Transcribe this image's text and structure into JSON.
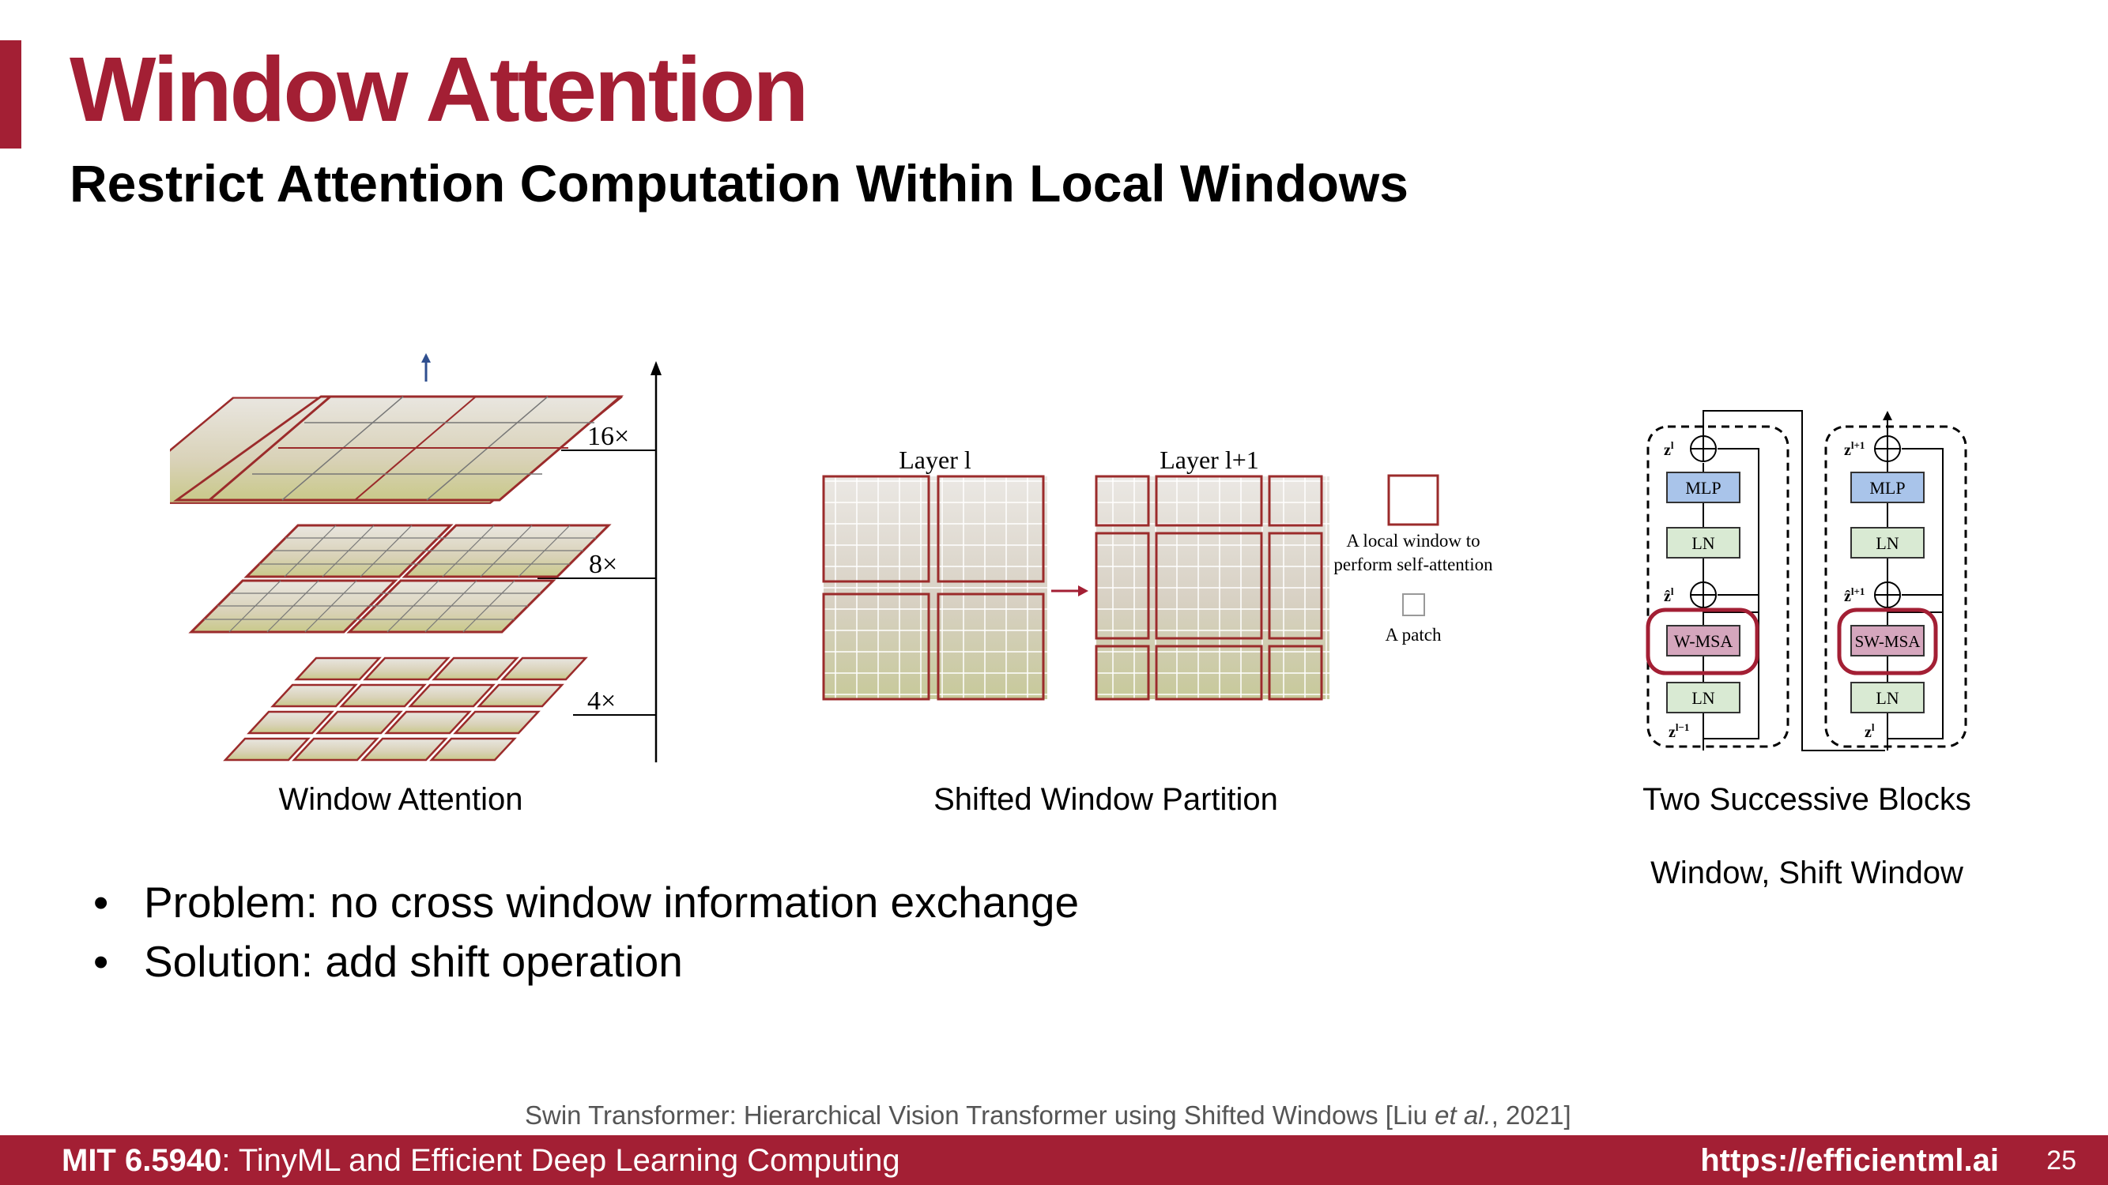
{
  "slide": {
    "title": "Window Attention",
    "subtitle": "Restrict Attention Computation Within Local Windows"
  },
  "figures": {
    "window_attention": {
      "caption": "Window Attention",
      "scales": [
        "16×",
        "8×",
        "4×"
      ]
    },
    "shifted_window": {
      "caption": "Shifted Window Partition",
      "layer_l": "Layer l",
      "layer_l1": "Layer l+1",
      "legend_window_line1": "A local window to",
      "legend_window_line2": "perform self-attention",
      "legend_patch": "A patch"
    },
    "blocks": {
      "caption": "Two Successive Blocks",
      "caption2": "Window, Shift Window",
      "block1": {
        "mlp": "MLP",
        "ln_top": "LN",
        "attn": "W-MSA",
        "ln_bottom": "LN",
        "z_out": "z",
        "z_out_sup": "l",
        "z_mid": "ẑ",
        "z_mid_sup": "l",
        "z_in": "z",
        "z_in_sup": "l−1"
      },
      "block2": {
        "mlp": "MLP",
        "ln_top": "LN",
        "attn": "SW-MSA",
        "ln_bottom": "LN",
        "z_out": "z",
        "z_out_sup": "l+1",
        "z_mid": "ẑ",
        "z_mid_sup": "l+1",
        "z_in": "z",
        "z_in_sup": "l"
      }
    }
  },
  "bullets": [
    "Problem: no cross window information exchange",
    "Solution: add shift operation"
  ],
  "citation": {
    "prefix": "Swin Transformer: Hierarchical Vision Transformer using Shifted Windows [Liu ",
    "italic": "et al.",
    "suffix": ", 2021]"
  },
  "footer": {
    "course_code": "MIT 6.5940",
    "course_name": ": TinyML and Efficient Deep Learning Computing",
    "url": "https://efficientml.ai",
    "page": "25"
  },
  "colors": {
    "accent": "#a31f34",
    "window_border": "#9b2b2b",
    "mlp_fill": "#a9c4ea",
    "ln_fill": "#d9ead3",
    "attn_fill": "#d5a6bd",
    "highlight": "#a31f34"
  }
}
